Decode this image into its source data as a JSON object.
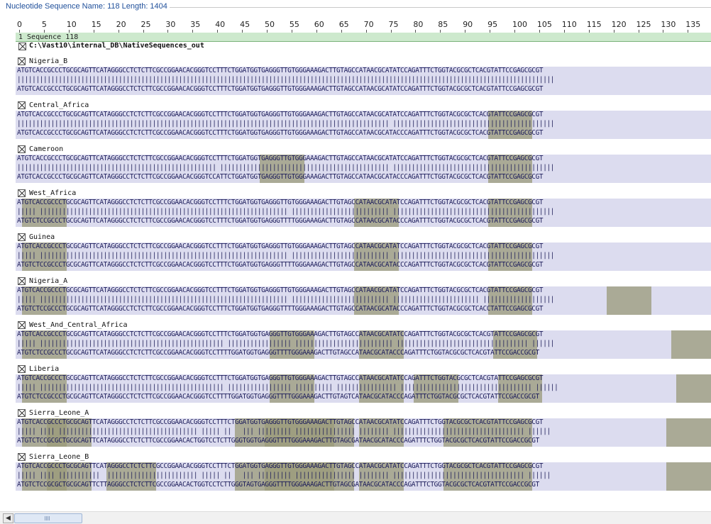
{
  "header": {
    "title": "Nucleotide Sequence Name:  118  Length:  1404"
  },
  "ruler": {
    "labels": [
      "0",
      "5",
      "10",
      "15",
      "20",
      "25",
      "30",
      "35",
      "40",
      "45",
      "50",
      "55",
      "60",
      "65",
      "70",
      "75",
      "80",
      "85",
      "90",
      "95",
      "100",
      "105",
      "110",
      "115",
      "120",
      "125",
      "130",
      "135"
    ]
  },
  "sequence_bar": {
    "label": "1 Sequence 118"
  },
  "source_path": "C:\\Vast10\\internal_DB\\NativeSequences_out",
  "alignments": [
    {
      "name": "Nigeria_B",
      "top": "ATGTCACCGCCCTGCGCAGTTCATAGGGCCTCTCTTCGCCGGAACACGGGTCCTTTCTGGATGGTGAGGGTTGTGGGAAAGACTTGTAGCCATAACGCATATCCAGATTTCTGGTACGCGCTCACGTATTCCGAGCGCGT",
      "mid": "|||||||||||||||||||||||||||||||||||||||||||||||||||||||||||||||||||||||||||||||||||||||||||||||||||||||||||||||||||||||||||||||||||||||||||||||",
      "bottom": "ATGTCACCGCCCTGCGCAGTTCATAGGGCCTCTCTTCGCCGGAACACGGGTCCTTTCTGGATGGTGAGGGTTGTGGGAAAGACTTGTAGCCATAACGCATATCCAGATTTCTGGTACGCGCTCACGTATTCCGAGCGCGT"
    },
    {
      "name": "Central_Africa",
      "top": "ATGTCACCGCCCTGCGCAGTTCATAGGGCCTCTCTTCGCCGGAACACGGGTCCTTTCTGGATGGTGAGGGTTGTGGGAAAGACTTGTAGCCATAACGCATATCCAGATTTCTGGTACGCGCTCACGTATTCCGAGCGCGT",
      "mid": "||||||||||||||||||||||||||||||||||||||||||||||||||||||||||||||||||||||||||||||||||||||||||||||||||| |||||||||||||||||||||||||||||||||||||||||||",
      "bottom": "ATGTCACCGCCCTGCGCAGTTCATAGGGCCTCTCTTCGCCGGAACACGGGTCCTTTCTGGATGGTGAGGGTTGTGGGAAAGACTTGTAGCCATAACGCATACCCAGATTTCTGGTACGCGCTCACGTATTCCGAGCGCGT"
    },
    {
      "name": "Cameroon",
      "top": "ATGTCACCGCCCTGCGCAGTTCATAGGGCCTCTCTTCGCCGGAACACGGGTCCTTTCTGGATGGTGAGGGTTGTGGGAAAGACTTGTAGCCATAACGCATATCCAGATTTCTGGTACGCGCTCACGTATTCCGAGCGCGT",
      "mid": "||||||||||||||||||||||||||||||||||||||||||||||||||||| ||||||||||||||||||||||||||||||||||||||||||||| |||||||||||||||||||||||||||||||||||||||||||",
      "bottom": "ATGTCACCGCCCTGCGCAGTTCATAGGGCCTCTCTTCGCCGGAACACGGGTCCATTCTGGATGGTGAGGGTTGTGGGAAAGACTTGTAGCCATAACGCATACCCAGATTTCTGGTACGCGCTCACGTATTCCGAGCGCGT"
    },
    {
      "name": "West_Africa",
      "top": "ATGTCACCGCCCTGCGCAGTTCATAGGGCCTCTCTTCGCCGGAACACGGGTCCTTTCTGGATGGTGAGGGTTGTGGGAAAGACTTGTAGCCATAACGCATATCCAGATTTCTGGTACGCGCTCACGTATTCCGAGCGCGT",
      "mid": "||||| |||||||||||||||||||||||||||||||||||||||||||||||||||||||||||||||||| |||||||||||||||||||||||||| |||||||||||||||||||||||||||||||||||||||||||",
      "bottom": "ATGTCTCCGCCCTGCGCAGTTCATAGGGCCTCTCTTCGCCGGAACACGGGTCCTTTCTGGATGGTGAGGGTTTTGGGAAAGACTTGTAGCCATAACGCATACCCAGATTTCTGGTACGCGCTCACGTATTCCGAGCGCGT"
    },
    {
      "name": "Guinea",
      "top": "ATGTCACCGCCCTGCGCAGTTCATAGGGCCTCTCTTCGCCGGAACACGGGTCCTTTCTGGATGGTGAGGGTTGTGGGAAAGACTTGTAGCCATAACGCATATCCAGATTTCTGGTACGCGCTCACGTATTCCGAGCGCGT",
      "mid": "||||| |||||||||||||||||||||||||||||||||||||||||||||||||||||||||||||||||| |||||||||||||||||||||||||| |||||||||||||||||||||||||||||||||||||||||||",
      "bottom": "ATGTCTCCGCCCTGCGCAGTTCATAGGGCCTCTCTTCGCCGGAACACGGGTCCTTTCTGGATGGTGAGGGTTTTGGGAAAGACTTGTAGCCATAACGCATACCCAGATTTCTGGTACGCGCTCACGTATTCCGAGCGCGT"
    },
    {
      "name": "Nigeria_A",
      "top": "ATGTCACCGCCCTGCGCAGTTCATAGGGCCTCTCTTCGCCGGAACACGGGTCCTTTCTGGATGGTGAGGGTTGTGGGAAAGACTTGTAGCCATAACGCATATCCAGATTTCTGGTACGCGCTCACGTATTCCGAGCGCGT",
      "mid": "||||| |||||||||||||||||||||||||||||||||||||||||||||||||||||||||||||||||| |||||||||||||||||||||||||| ||||||||||||||||||||||| |||||||||||||||||||",
      "bottom": "ATGTCTCCGCCCTGCGCAGTTCATAGGGCCTCTCTTCGCCGGAACACGGGTCCTTTCTGGATGGTGAGGGTTTTGGGAAAGACTTGTAGCCATAACGCATACCCAGATTTCTGGTACGCGCTCACCTATTCCGAGCGCGT"
    },
    {
      "name": "West_And_Central_Africa",
      "top": "ATGTCACCGCCCTGCGCAGTTCATAGGGCCTCTCTTCGCCGGAACACGGGTCCTTTCTGGATGGTGAGGGTTGTGGGAAAGACTTGTAGCCATAACGCATATCCAGATTTCTGGTACGCGCTCACGTATTCCGAGCGCGT",
      "mid": "||||| ||||||||||||||||||||||||||||||||||||||||||||||||| ||||||||||||||||| |||||||||||||||||||||||||| ||||||||||||||||||||||||||||||||||| ||||||",
      "bottom": "ATGTCTCCGCCCTGCGCAGTTCATAGGGCCTCTCTTCGCCGGAACACGGGTCCTTTTGGATGGTGAGGGTTTTGGGAAAGACTTGTAGCCATAACGCATACCCAGATTTCTGGTACGCGCTCACGTATTCCGACCGCGT"
    },
    {
      "name": "Liberia",
      "top": "ATGTCACCGCCCTGCGCAGTTCATAGGGCCTCTCTTCGCCGGAACACGGGTCCTTTCTGGATGGTGAGGGTTGTGGGAAAGACTTGTAGCCATAACGCATATCCAGATTTCTGGTACGCGCTCACGTATTCCGAGCGCGT",
      "mid": "||||| ||||||||||||||||||||||||||||||||||||||||||||||||| ||||||||||||||||| |||||||||| |||||||||||||||| ||||||||||||||||||||||||||||||||||| ||||||",
      "bottom": "ATGTCTCCGCCCTGCGCAGTTCATAGGGCCTCTCTTCGCCGGAACACGGGTCCTTTTGGATGGTGAGGGTTTTGGGAAAGACTTGTAGTCATAACGCATACCCAGATTTCTGGTACGCGCTCACGTATTCCGACCGCGT"
    },
    {
      "name": "Sierra_Leone_A",
      "top": "ATGTCACCGCCCTGCGCAGTTCATAGGGCCTCTCTTCGCCGGAACACGGGTCCTTTCTGGATGGTGAGGGTTGTGGGAAAGACTTGTAGCCATAACGCATATCCAGATTTCTGGTACGCGCTCACGTATTCCGAGCGCGT",
      "mid": "||||| |||| ||||||||||||||||||||||||||||||||||||| ||||| ||   ||| ||||||||| |||||||||||||||| |||||||| ||||||||||||||||||||||||||||||||||| ||||||",
      "bottom": "ATGTCTCCGCGCTGCGCAGTTCATAGGGCCTCTCTTCGCCGGAACACTGGTCCTCTTGGGTGGTGAGGGTTTTGGGAAAGACTTGTAGCGATAACGCATACCCAGATTTCTGGTACGCGCTCACGTATTCCGACCGCGT"
    },
    {
      "name": "Sierra_Leone_B",
      "top": "ATGTCACCGCCCTGCGCAGTTCATAGGGCCTCTCTTCGCCGGAACACGGGTCCTTTCTGGATGGTGAGGGTTGTGGGAAAGACTTGTAGCCATAACGCATATCCAGATTTCTGGTACGCGCTCACGTATTCCGAGCGCGT",
      "mid": "||||| |||| |||||||||||  |||||||||||||||||||||||| ||||| ||   ||| ||||||||| |||||||||||||||| |||||||| ||||||||||||||||||||||||||||||||||| ||||||",
      "bottom": "ATGTCTCCGCGCTGCGCAGTTCTTAGGGCCTCTCTTCGCCGGAACACTGGTCCTCTTGGGTAGTGAGGGTTTTGGGAAAGACTTGTAGCGATAACGCATACCCAGATTTCTGGTACGCGCTCACGTATTCCGACCGCGT"
    }
  ]
}
